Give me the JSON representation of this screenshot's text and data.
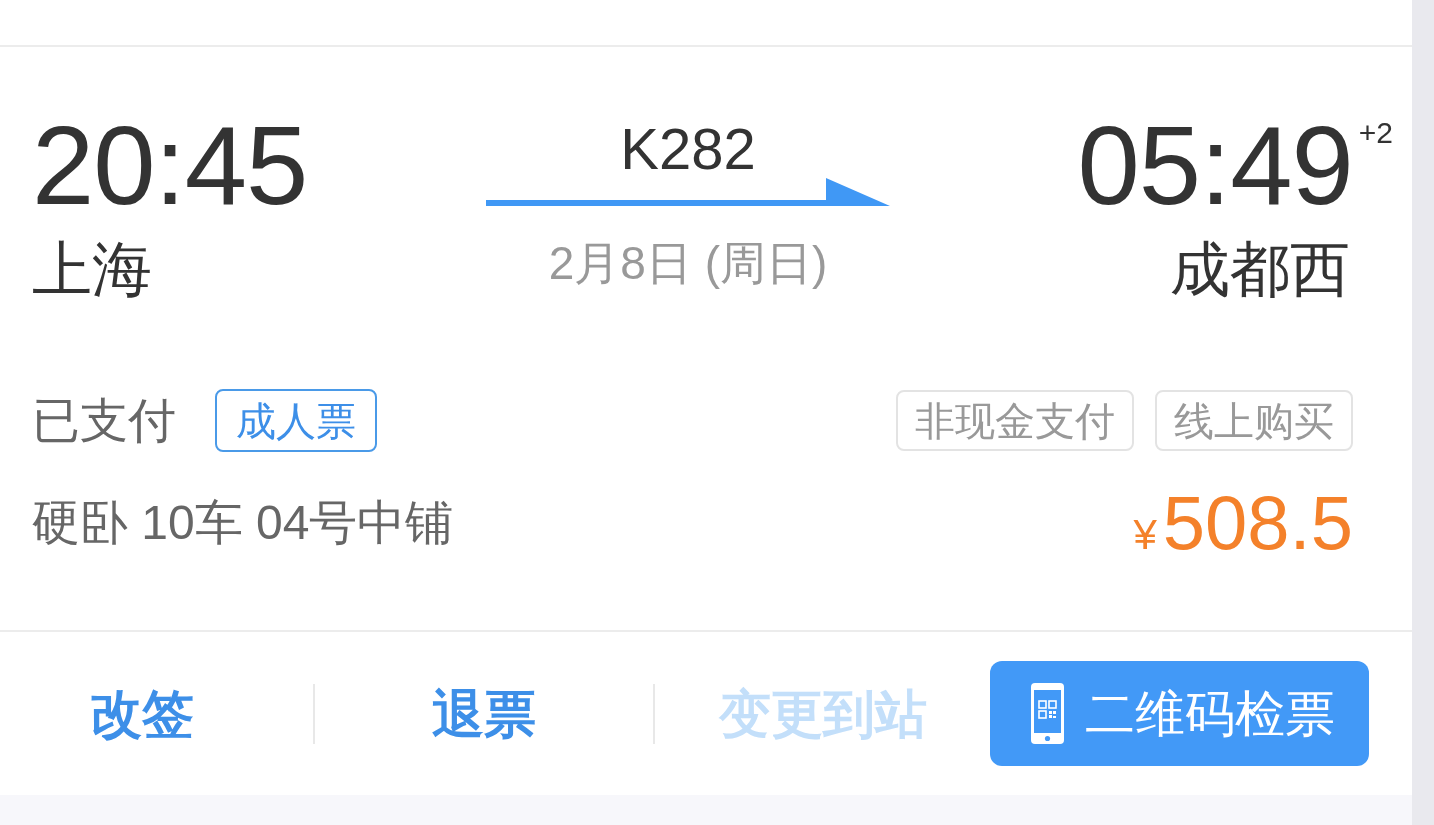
{
  "departure": {
    "time": "20:45",
    "station": "上海"
  },
  "train": {
    "number": "K282",
    "date": "2月8日 (周日)"
  },
  "arrival": {
    "time": "05:49",
    "day_offset": "+2",
    "station": "成都西"
  },
  "status": "已支付",
  "ticket_type": "成人票",
  "tags": [
    "非现金支付",
    "线上购买"
  ],
  "seat": "硬卧 10车 04号中铺",
  "price": {
    "currency": "¥",
    "amount": "508.5"
  },
  "actions": [
    {
      "label": "改签",
      "kind": "text",
      "disabled": false
    },
    {
      "label": "退票",
      "kind": "text",
      "disabled": false
    },
    {
      "label": "变更到站",
      "kind": "text",
      "disabled": true
    },
    {
      "label": "二维码检票",
      "kind": "primary",
      "disabled": false
    }
  ]
}
